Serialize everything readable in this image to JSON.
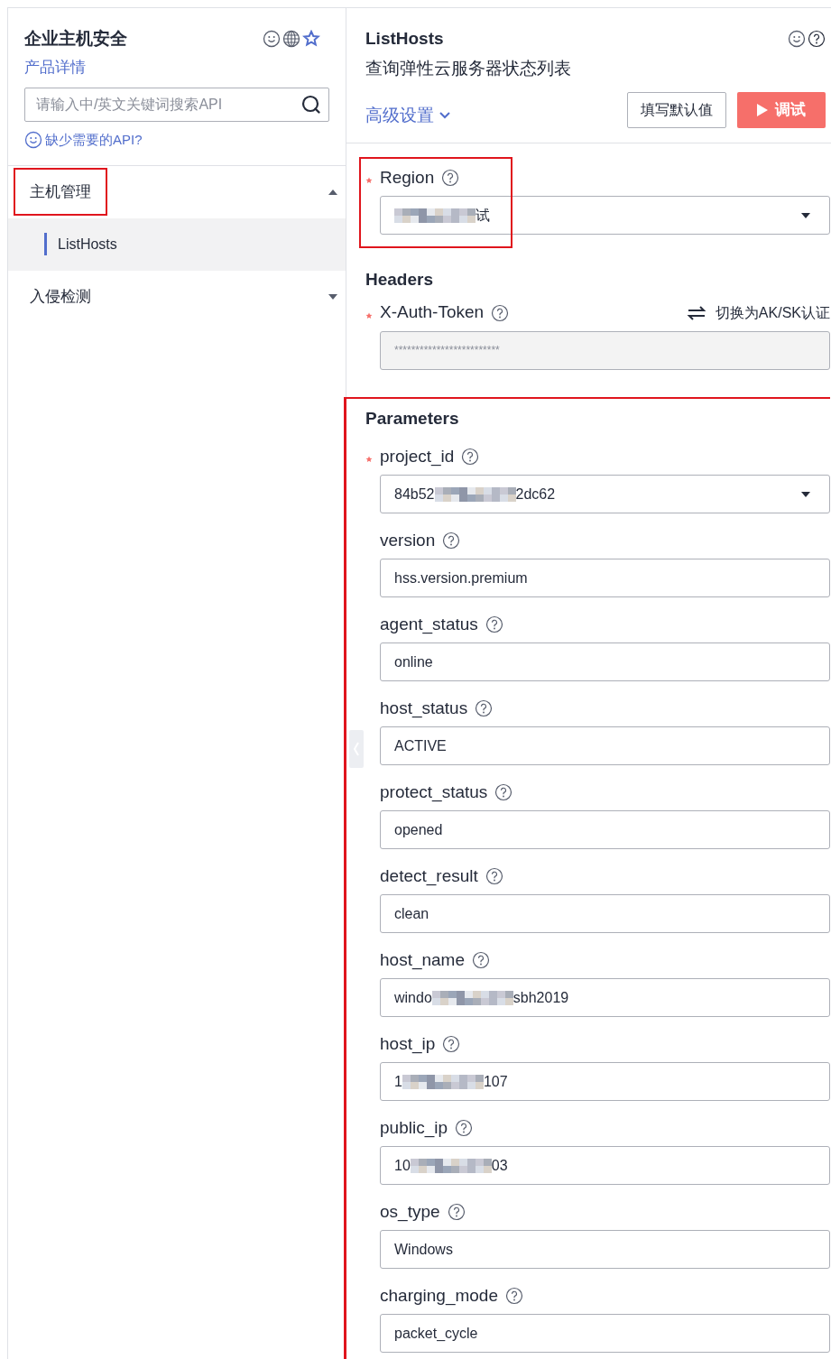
{
  "sidebar": {
    "title": "企业主机安全",
    "product_link": "产品详情",
    "search": {
      "placeholder": "请输入中/英文关键词搜索API"
    },
    "missing_api_link": "缺少需要的API?",
    "menu": [
      {
        "label": "主机管理",
        "expanded": true,
        "highlighted": true,
        "children": [
          {
            "label": "ListHosts",
            "selected": true
          }
        ]
      },
      {
        "label": "入侵检测",
        "expanded": false,
        "highlighted": false
      }
    ]
  },
  "main": {
    "title": "ListHosts",
    "subtitle": "查询弹性云服务器状态列表",
    "advanced_settings": "高级设置",
    "buttons": [
      {
        "label": "填写默认值",
        "kind": "secondary"
      },
      {
        "label": "调试",
        "kind": "primary"
      }
    ],
    "region": {
      "label": "Region",
      "required": true,
      "highlighted": true,
      "redacted": true,
      "tail": "试"
    },
    "headers": {
      "heading": "Headers",
      "field": {
        "label": "X-Auth-Token",
        "required": true,
        "switch_link": "切换为AK/SK认证",
        "value": "*************************",
        "disabled": true
      }
    },
    "parameters": {
      "heading": "Parameters",
      "highlighted": true,
      "fields": [
        {
          "label": "project_id",
          "required": true,
          "kind": "select",
          "value": "84b52",
          "redacted": true,
          "tail": "2dc62"
        },
        {
          "label": "version",
          "required": false,
          "kind": "input",
          "value": "hss.version.premium",
          "redacted": false
        },
        {
          "label": "agent_status",
          "required": false,
          "kind": "input",
          "value": "online",
          "redacted": false
        },
        {
          "label": "host_status",
          "required": false,
          "kind": "input",
          "value": "ACTIVE",
          "redacted": false
        },
        {
          "label": "protect_status",
          "required": false,
          "kind": "input",
          "value": "opened",
          "redacted": false
        },
        {
          "label": "detect_result",
          "required": false,
          "kind": "input",
          "value": "clean",
          "redacted": false
        },
        {
          "label": "host_name",
          "required": false,
          "kind": "input",
          "value": "windo",
          "redacted": true,
          "tail": "sbh2019"
        },
        {
          "label": "host_ip",
          "required": false,
          "kind": "input",
          "value": "1",
          "redacted": true,
          "tail": "107"
        },
        {
          "label": "public_ip",
          "required": false,
          "kind": "input",
          "value": "10",
          "redacted": true,
          "tail": "03"
        },
        {
          "label": "os_type",
          "required": false,
          "kind": "input",
          "value": "Windows",
          "redacted": false
        },
        {
          "label": "charging_mode",
          "required": false,
          "kind": "input",
          "value": "packet_cycle",
          "redacted": false
        }
      ]
    }
  }
}
